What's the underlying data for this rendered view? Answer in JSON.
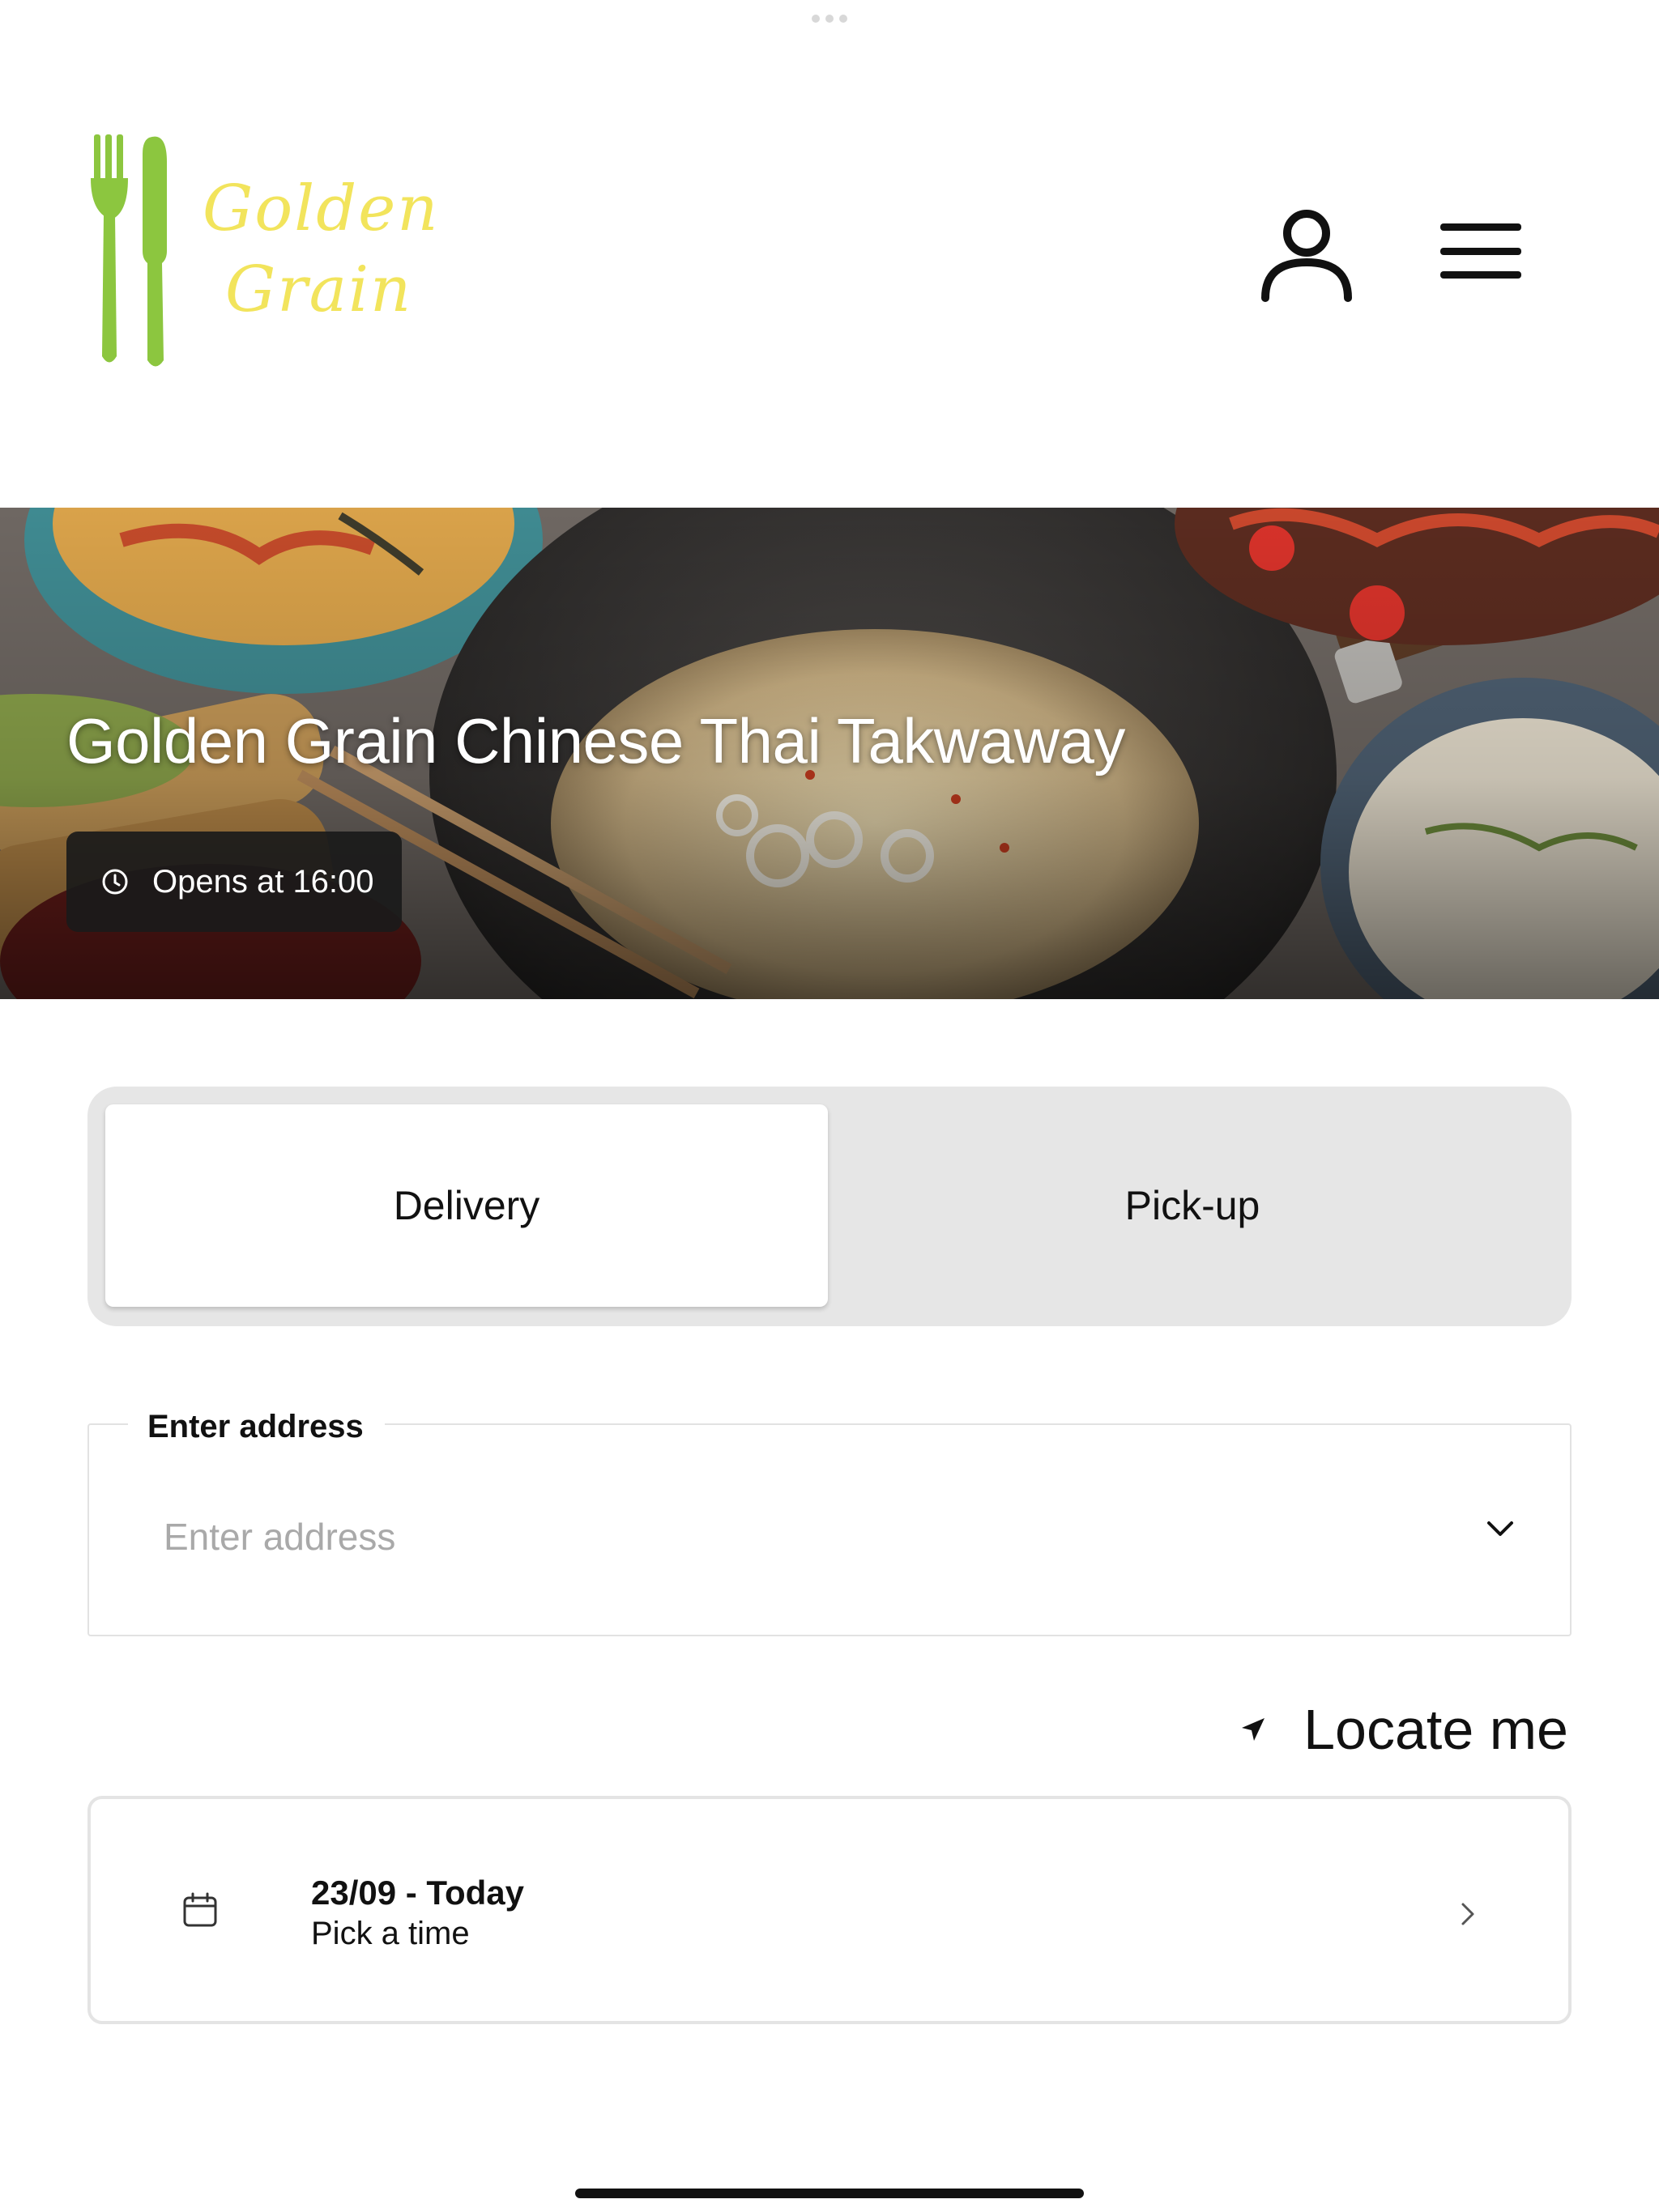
{
  "header": {
    "logo_line1": "Golden",
    "logo_line2": "Grain",
    "logo_icon": "fork-knife-icon",
    "user_icon": "user-icon",
    "menu_icon": "hamburger-menu-icon"
  },
  "hero": {
    "title": "Golden Grain Chinese Thai Takwaway",
    "status_text": "Opens at 16:00",
    "status_icon": "clock-icon"
  },
  "order_type": {
    "options": [
      "Delivery",
      "Pick-up"
    ],
    "selected": "Delivery"
  },
  "address": {
    "label": "Enter address",
    "placeholder": "Enter address",
    "value": ""
  },
  "locate": {
    "label": "Locate me",
    "icon": "location-arrow-icon"
  },
  "time": {
    "date_label": "23/09 - Today",
    "pick_label": "Pick a time",
    "icon": "calendar-icon"
  },
  "colors": {
    "logo_green": "#8cc63f",
    "logo_yellow": "#f2e45c",
    "toggle_bg": "#e6e6e6",
    "badge_bg": "#1a1a1a"
  }
}
